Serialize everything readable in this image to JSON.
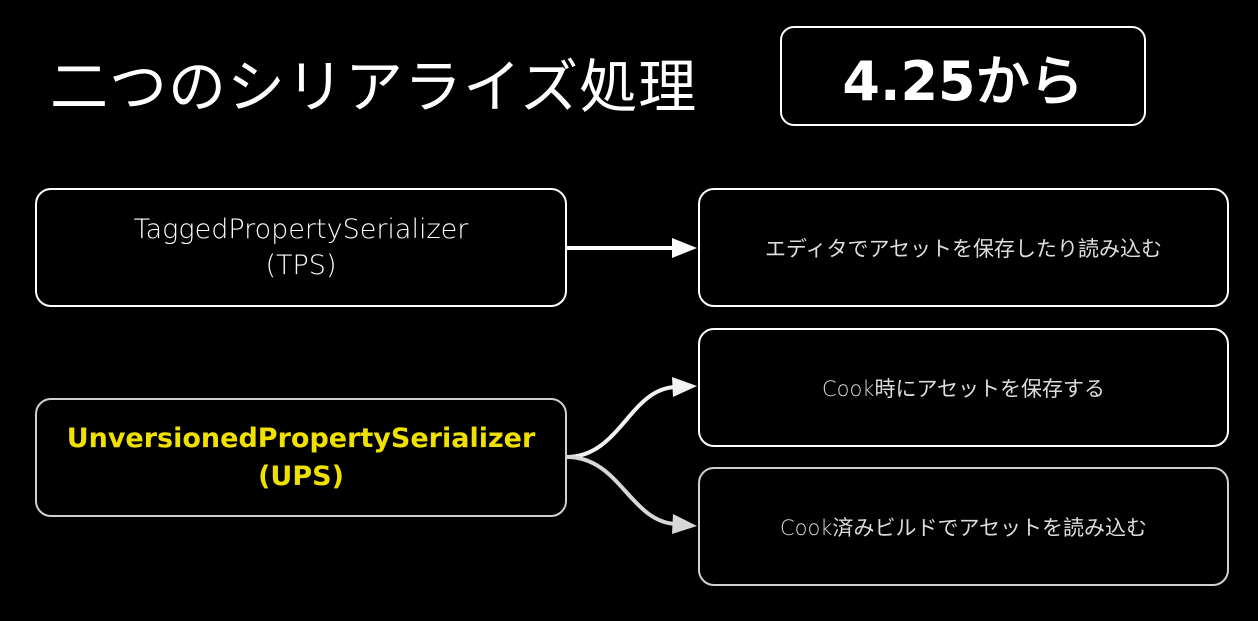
{
  "title": "二つのシリアライズ処理",
  "badge": "4.25から",
  "serializers": [
    {
      "name": "TaggedPropertySerializer",
      "abbr": "(TPS)"
    },
    {
      "name": "UnversionedPropertySerializer",
      "abbr": "(UPS)",
      "highlight_color": "#f0e000"
    }
  ],
  "uses": [
    "エディタでアセットを保存したり読み込む",
    "Cook時にアセットを保存する",
    "Cook済みビルドでアセットを読み込む"
  ]
}
